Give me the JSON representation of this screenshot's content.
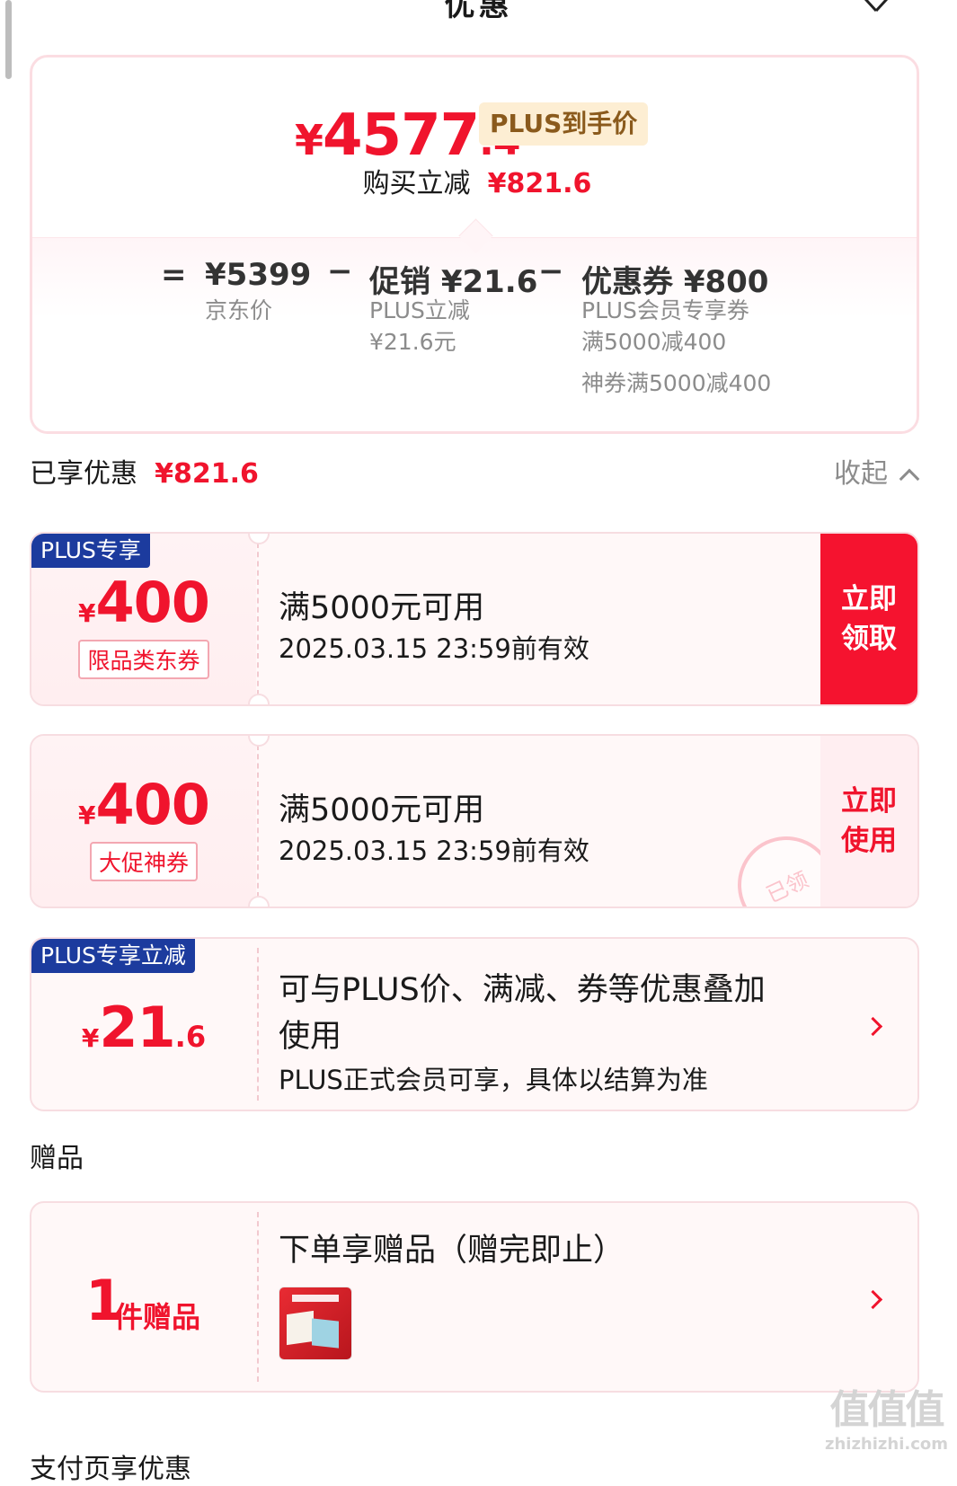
{
  "header": {
    "title": "优惠"
  },
  "summary": {
    "price_symbol": "¥",
    "price_int": "4577",
    "price_dec": ".4",
    "price_tag": "PLUS到手价",
    "save_label": "购买立减",
    "save_value": "¥821.6",
    "equals": "=",
    "minus": "−",
    "items": [
      {
        "main": "¥5399",
        "sub": [
          "京东价"
        ]
      },
      {
        "main": "促销 ¥21.6",
        "sub": [
          "PLUS立减",
          "¥21.6元"
        ]
      },
      {
        "main": "优惠券 ¥800",
        "sub": [
          "PLUS会员专享券",
          "满5000减400"
        ],
        "extra": "神券满5000减400"
      }
    ]
  },
  "enjoyed": {
    "label": "已享优惠",
    "value": "¥821.6",
    "collapse_label": "收起"
  },
  "coupons": [
    {
      "badge": "PLUS专享",
      "yen": "¥",
      "amount": "400",
      "chip": "限品类东券",
      "title": "满5000元可用",
      "date": "2025.03.15 23:59前有效",
      "action": "立即领取"
    },
    {
      "yen": "¥",
      "amount": "400",
      "chip": "大促神券",
      "title": "满5000元可用",
      "date": "2025.03.15 23:59前有效",
      "action": "立即使用",
      "stamp": "已领"
    }
  ],
  "plus_discount": {
    "badge": "PLUS专享立减",
    "yen": "¥",
    "amount_int": "21",
    "amount_dec": ".6",
    "title_line1": "可与PLUS价、满减、券等优惠叠加",
    "title_line2": "使用",
    "desc": "PLUS正式会员可享，具体以结算为准"
  },
  "gifts": {
    "section_label": "赠品",
    "count": "1",
    "count_unit": "件赠品",
    "title": "下单享赠品（赠完即止）"
  },
  "next_section": {
    "label": "支付页享优惠"
  },
  "watermark": {
    "text": "值值值",
    "site": "zhizhizhi.com"
  },
  "colors": {
    "accent": "#f0142d",
    "plus_badge": "#1c3b9e",
    "plus_tag_bg": "#fdeed3",
    "card_border": "#f7dde1"
  },
  "icons": [
    "close-icon",
    "chevron-up-icon",
    "chevron-right-icon",
    "gift-product-thumbnail"
  ]
}
